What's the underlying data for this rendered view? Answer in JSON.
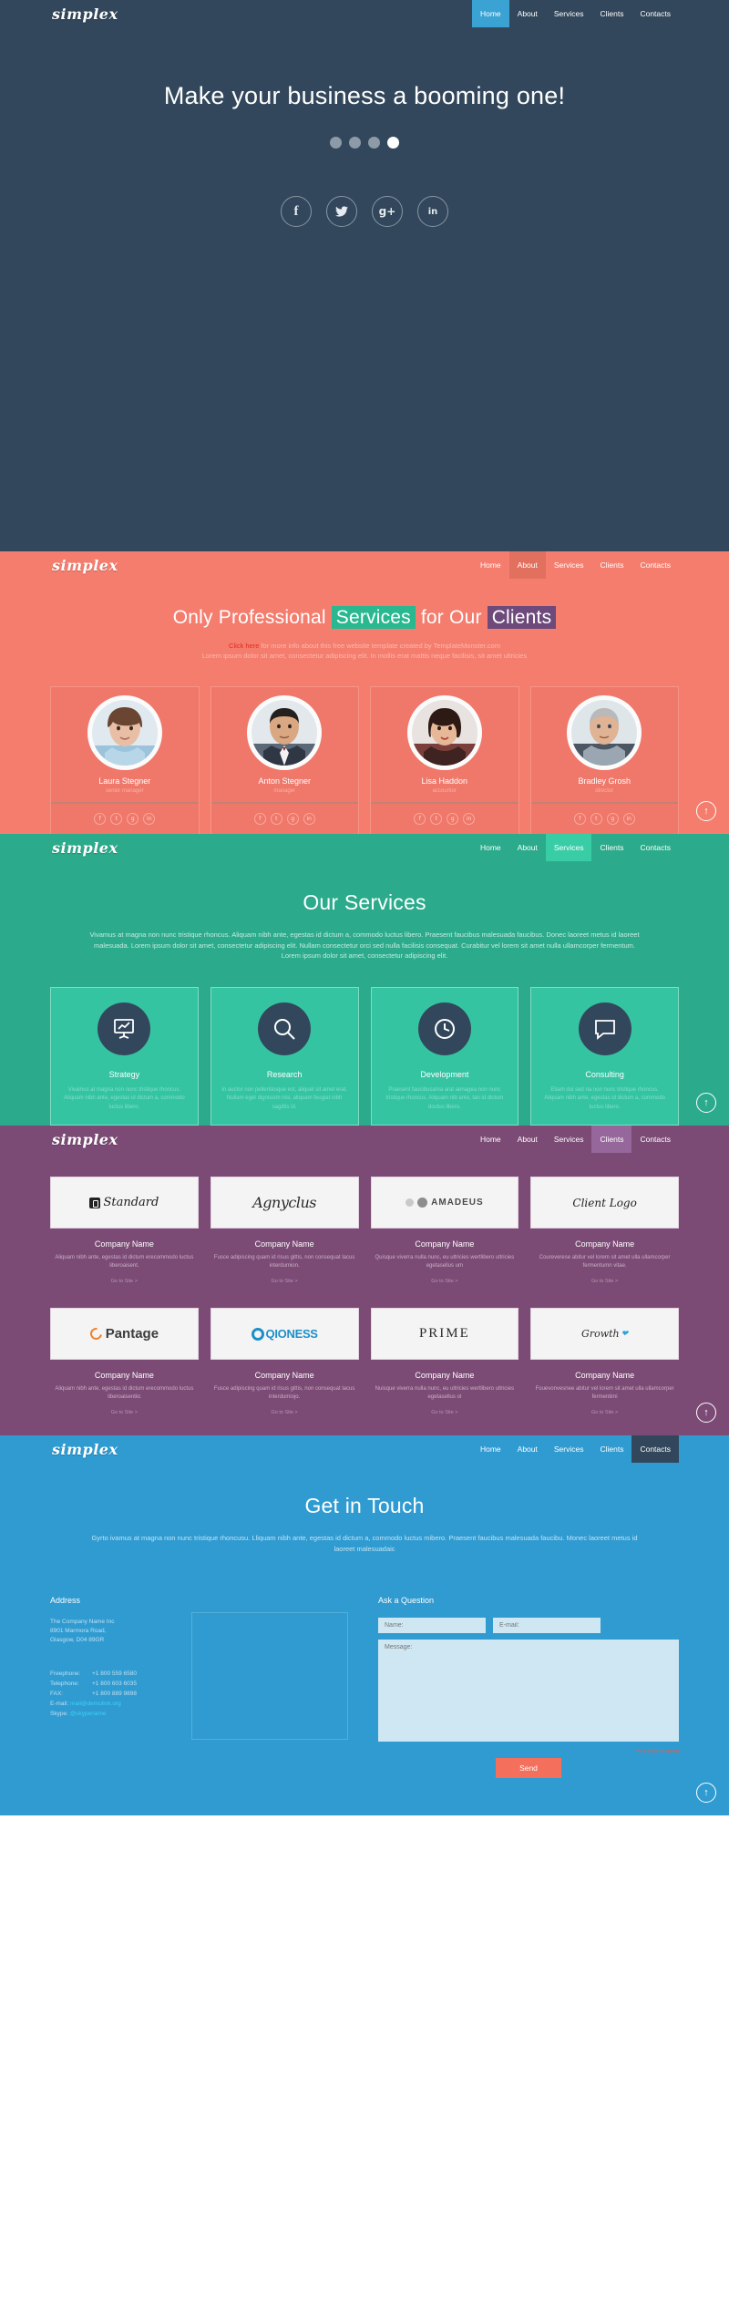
{
  "brand": {
    "logo_text": "simplex"
  },
  "nav": {
    "items": [
      "Home",
      "About",
      "Services",
      "Clients",
      "Contacts"
    ],
    "active_hero": "Home",
    "active_about": "About",
    "active_services": "Services",
    "active_clients": "Clients",
    "active_contacts": "Contacts"
  },
  "hero": {
    "title": "Make your business a booming one!",
    "dots": [
      "dot-1",
      "dot-2",
      "dot-3",
      "dot-4"
    ],
    "active_dot_index": 3,
    "socials": [
      {
        "name": "facebook-icon",
        "glyph": "f"
      },
      {
        "name": "twitter-icon",
        "glyph": "ᵗ"
      },
      {
        "name": "google-plus-icon",
        "glyph": "g+"
      },
      {
        "name": "linkedin-icon",
        "glyph": "in"
      }
    ]
  },
  "about": {
    "heading_part1": "Only Professional ",
    "heading_hl1": "Services",
    "heading_part2": " for Our ",
    "heading_hl2": "Clients",
    "sub_link": "Click here",
    "sub_line1": " for more info about this free website template created by TemplateMonster.com",
    "sub_line2": "Lorem ipsum dolor sit amet, consectetur adipiscing elit. In mollis erat mattis neque facilisis, sit amet ultricies",
    "team": [
      {
        "name": "Laura Stegner",
        "role": "senior manager"
      },
      {
        "name": "Anton Stegner",
        "role": "manager"
      },
      {
        "name": "Lisa Haddon",
        "role": "accountor"
      },
      {
        "name": "Bradley Grosh",
        "role": "director"
      }
    ],
    "mini_socials": [
      "f",
      "t",
      "g",
      "in"
    ]
  },
  "services": {
    "title": "Our Services",
    "body": "Vivamus at magna non nunc tristique rhoncus. Aliquam nibh ante, egestas id dictum a, commodo luctus libero. Praesent faucibus malesuada faucibus. Donec laoreet metus id laoreet malesuada. Lorem ipsum dolor sit amet, consectetur adipiscing elit. Nullam consectetur orci sed nulla facilisis consequat. Curabitur vel lorem sit amet nulla ullamcorper fermentum. Lorem ipsum dolor sit amet, consectetur adipiscing elit.",
    "cards": [
      {
        "icon": "chart-board-icon",
        "name": "Strategy",
        "text": "Vivamus at magna non nunc tristique rhoncus. Aliquam nibh ante, egestas id dictum a, commodo luctus libero."
      },
      {
        "icon": "magnifier-icon",
        "name": "Research",
        "text": "In auctor non pellentesque est, aliquet sit amet erat. Nullam eget dignissim nisi, aliquam feugiat nibh sagittis id."
      },
      {
        "icon": "clock-icon",
        "name": "Development",
        "text": "Praesent faucibusama arat aenagea non nunc tristique rhoncus. Aliquam nib ante, tan id dictum doctus libero."
      },
      {
        "icon": "chat-bubble-icon",
        "name": "Consulting",
        "text": "Etiam dui sed na non nunc tristique rhoncus. Aliquam nibh ante, egestas id dictum a, commodo luctus libero."
      }
    ]
  },
  "clients": {
    "row1": [
      {
        "logo": "standard-logo",
        "logo_text": "Standard",
        "company": "Company Name",
        "desc": "Aliquam nibh ante, egestas id dictum erecommodo luctus liberoaisent.",
        "link": "Go to Site >"
      },
      {
        "logo": "agnyclus-logo",
        "logo_text": "Agnyclus",
        "company": "Company Name",
        "desc": "Fusce adipiscing quam id risus gittis, non consequat lacus interdumion.",
        "link": "Go to Site >"
      },
      {
        "logo": "amadeus-logo",
        "logo_text": "AMADEUS",
        "company": "Company Name",
        "desc": "Quisque viverra nulla nunc, eu ultricies wertlibero ultricies egetasellus um",
        "link": "Go to Site >"
      },
      {
        "logo": "client-logo",
        "logo_text": "Client Logo",
        "company": "Company Name",
        "desc": "Coureverese abitur vel lorem sit amet ulla ullamcorper fermentumn vitae.",
        "link": "Go to Site >"
      }
    ],
    "row2": [
      {
        "logo": "pantage-logo",
        "logo_text": "Pantage",
        "company": "Company Name",
        "desc": "Aliquam nibh ante, egestas id dictum erecommodo luctus liberoaisentiic",
        "link": "Go to Site >"
      },
      {
        "logo": "qioness-logo",
        "logo_text": "QIONESS",
        "company": "Company Name",
        "desc": "Fusce adipiscing quam id risus gittis, non consequat lacus interdumiojo.",
        "link": "Go to Site >"
      },
      {
        "logo": "prime-logo",
        "logo_text": "PRIME",
        "company": "Company Name",
        "desc": "Nuisque viverra nulla nunc, eu ultricies wertlibero ultricies egetasellus ol",
        "link": "Go to Site >"
      },
      {
        "logo": "growth-logo",
        "logo_text": "Growth",
        "company": "Company Name",
        "desc": "Fouevonvesnee abitur vel lorem sit amet ulla ullamcorper fermentimi",
        "link": "Go to Site >"
      }
    ]
  },
  "contacts": {
    "title": "Get in Touch",
    "body": "Gyrto ivamus at magna non nunc tristique rhoncusu. Lliquam nibh ante, egestas id dictum a, commodo luctus mibero. Praesent faucibus malesuada faucibu. Monec laoreet metus id laoreet malesuadaic",
    "address_heading": "Address",
    "address_lines": [
      "The Company Name Inc",
      "8901 Marmora Road,",
      "Glasgow, D04 89GR"
    ],
    "phone_rows": [
      {
        "label": "Freephone:",
        "value": "+1 800 559 6580"
      },
      {
        "label": "Telephone:",
        "value": "+1 800 603 6035"
      },
      {
        "label": "FAX:",
        "value": "+1 800 889 9898"
      }
    ],
    "email_label": "E-mail:",
    "email_value": "mail@demolink.org",
    "skype_label": "Skype:",
    "skype_value": "@skypename",
    "form_heading": "Ask a Question",
    "name_placeholder": "Name:",
    "email_placeholder": "E-mail:",
    "message_placeholder": "Message:",
    "required_note": "*All Fields Required",
    "send_label": "Send"
  },
  "to_top_glyph": "↑"
}
